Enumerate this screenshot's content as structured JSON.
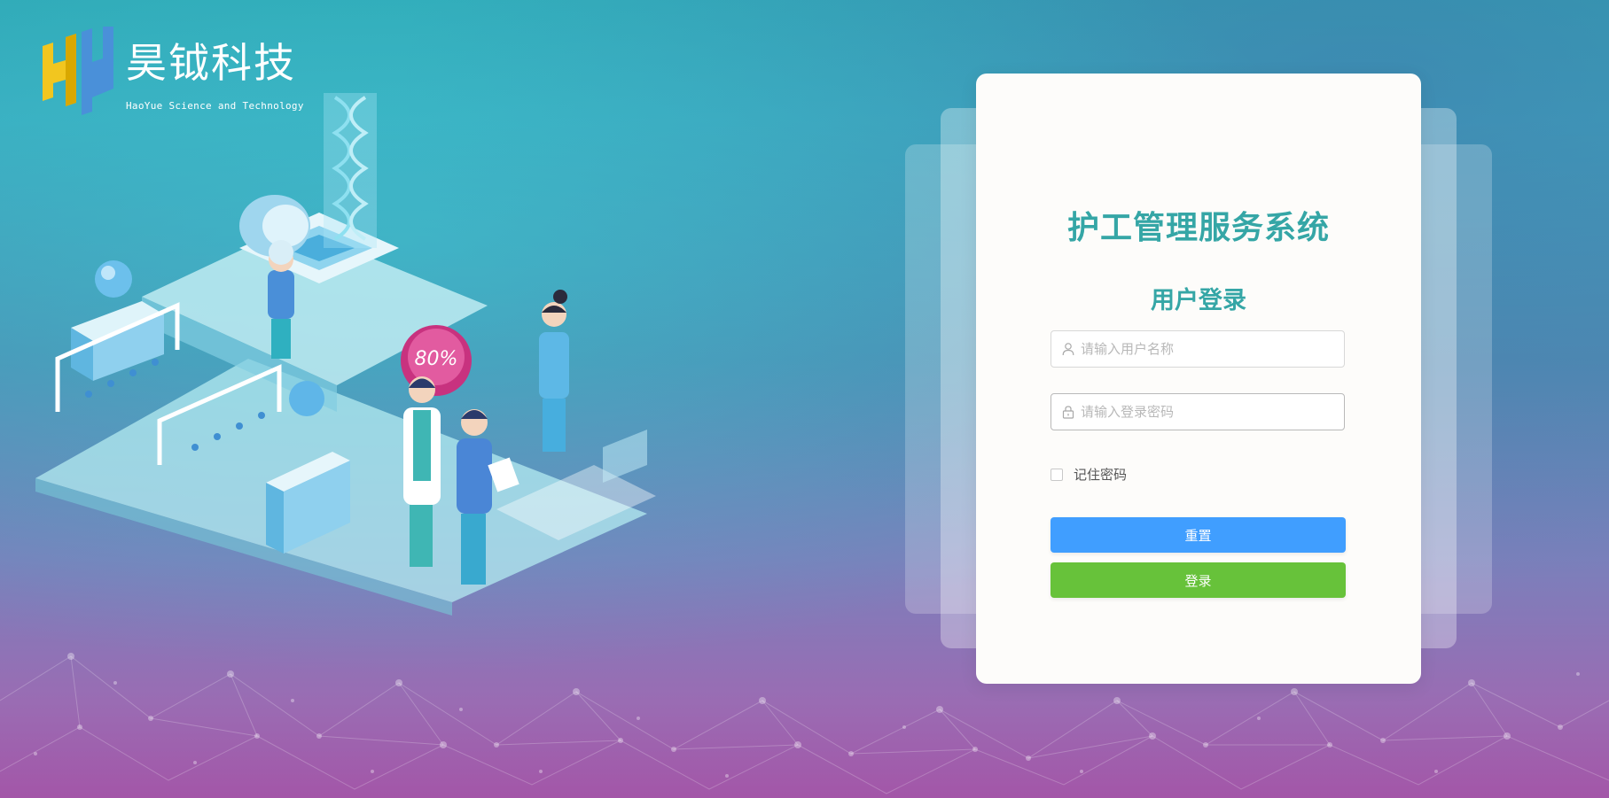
{
  "logo": {
    "title": "昊钺科技",
    "subtitle": "HaoYue Science and Technology",
    "mark_colors": [
      "#f2c61f",
      "#4a90d9"
    ]
  },
  "illustration": {
    "badge_text": "80%"
  },
  "login": {
    "system_title": "护工管理服务系统",
    "form_title": "用户登录",
    "username_placeholder": "请输入用户名称",
    "username_value": "",
    "password_placeholder": "请输入登录密码",
    "password_value": "",
    "username_icon": "user-icon",
    "password_icon": "lock-icon",
    "remember_label": "记住密码",
    "remember_checked": false,
    "reset_label": "重置",
    "login_label": "登录"
  },
  "colors": {
    "title": "#35a6a6",
    "reset_button": "#409eff",
    "login_button": "#67c23a"
  }
}
